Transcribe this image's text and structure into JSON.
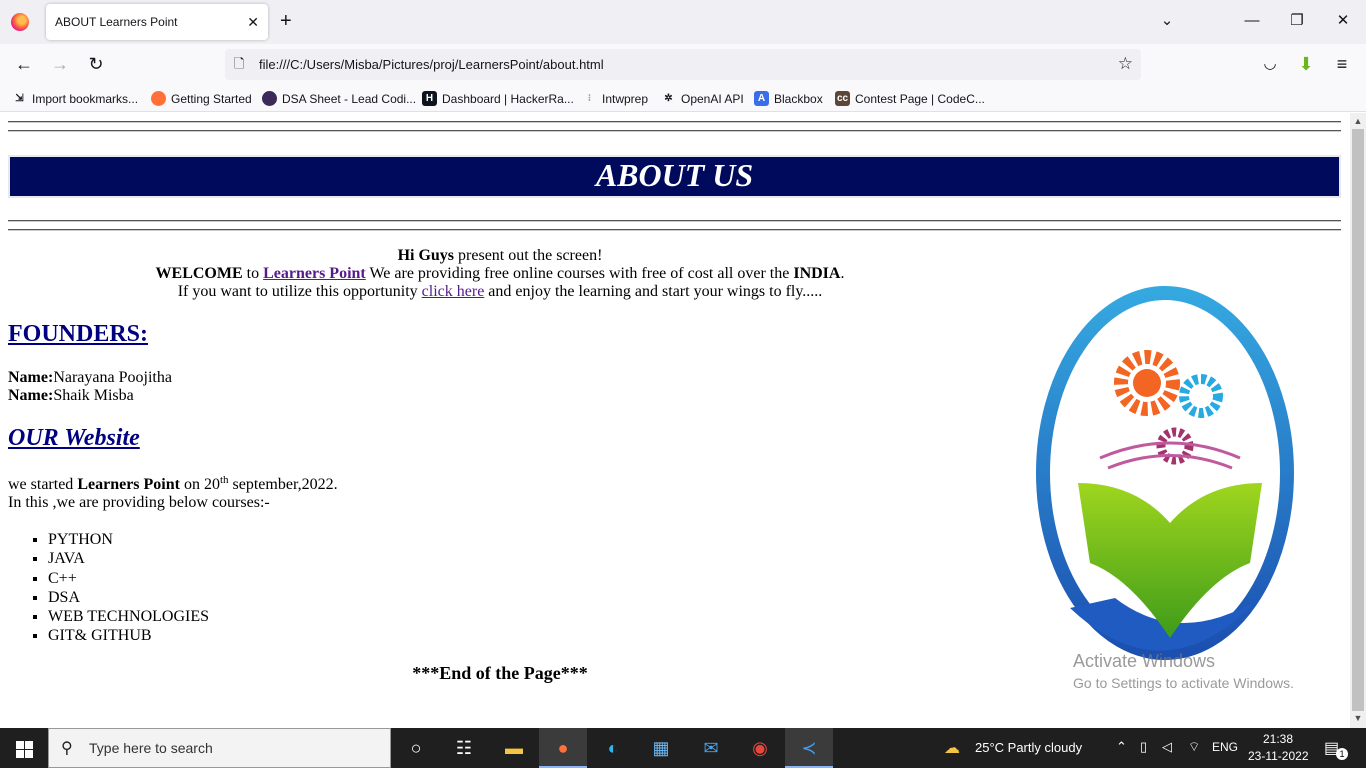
{
  "browser": {
    "tab_title": "ABOUT Learners Point",
    "url": "file:///C:/Users/Misba/Pictures/proj/LearnersPoint/about.html",
    "bookmarks": [
      "Import bookmarks...",
      "Getting Started",
      "DSA Sheet - Lead Codi...",
      "Dashboard | HackerRa...",
      "Intwprep",
      "OpenAI API",
      "Blackbox",
      "Contest Page | CodeC..."
    ]
  },
  "page": {
    "banner_title": "ABOUT US",
    "intro": {
      "line1_bold": "Hi Guys",
      "line1_rest": " present out the screen!",
      "line2_bold1": "WELCOME",
      "line2_to": " to ",
      "line2_link": "Learners Point",
      "line2_mid": " We are providing free online courses with free of cost all over the ",
      "line2_bold2": "INDIA",
      "line2_end": ".",
      "line3_start": "If you want to utilize this opportunity ",
      "line3_link": "click here",
      "line3_end": " and enjoy the learning and start your wings to fly....."
    },
    "founders_heading": "FOUNDERS:",
    "founders": [
      {
        "label": "Name:",
        "value": "Narayana Poojitha"
      },
      {
        "label": "Name:",
        "value": "Shaik Misba"
      }
    ],
    "website_heading": "OUR Website",
    "started": {
      "a": "we started ",
      "b": "Learners Point",
      "c": " on 20",
      "sup": "th",
      "d": " september,2022."
    },
    "courses_intro": "In this ,we are providing below courses:-",
    "courses": [
      "PYTHON",
      "JAVA",
      "C++",
      "DSA",
      "WEB TECHNOLOGIES",
      "GIT& GITHUB"
    ],
    "end_text": "***End of the Page***",
    "watermark_line1": "Activate Windows",
    "watermark_line2": "Go to Settings to activate Windows."
  },
  "taskbar": {
    "search_placeholder": "Type here to search",
    "weather": "25°C  Partly cloudy",
    "lang": "ENG",
    "time": "21:38",
    "date": "23-11-2022",
    "notifications": "1"
  }
}
